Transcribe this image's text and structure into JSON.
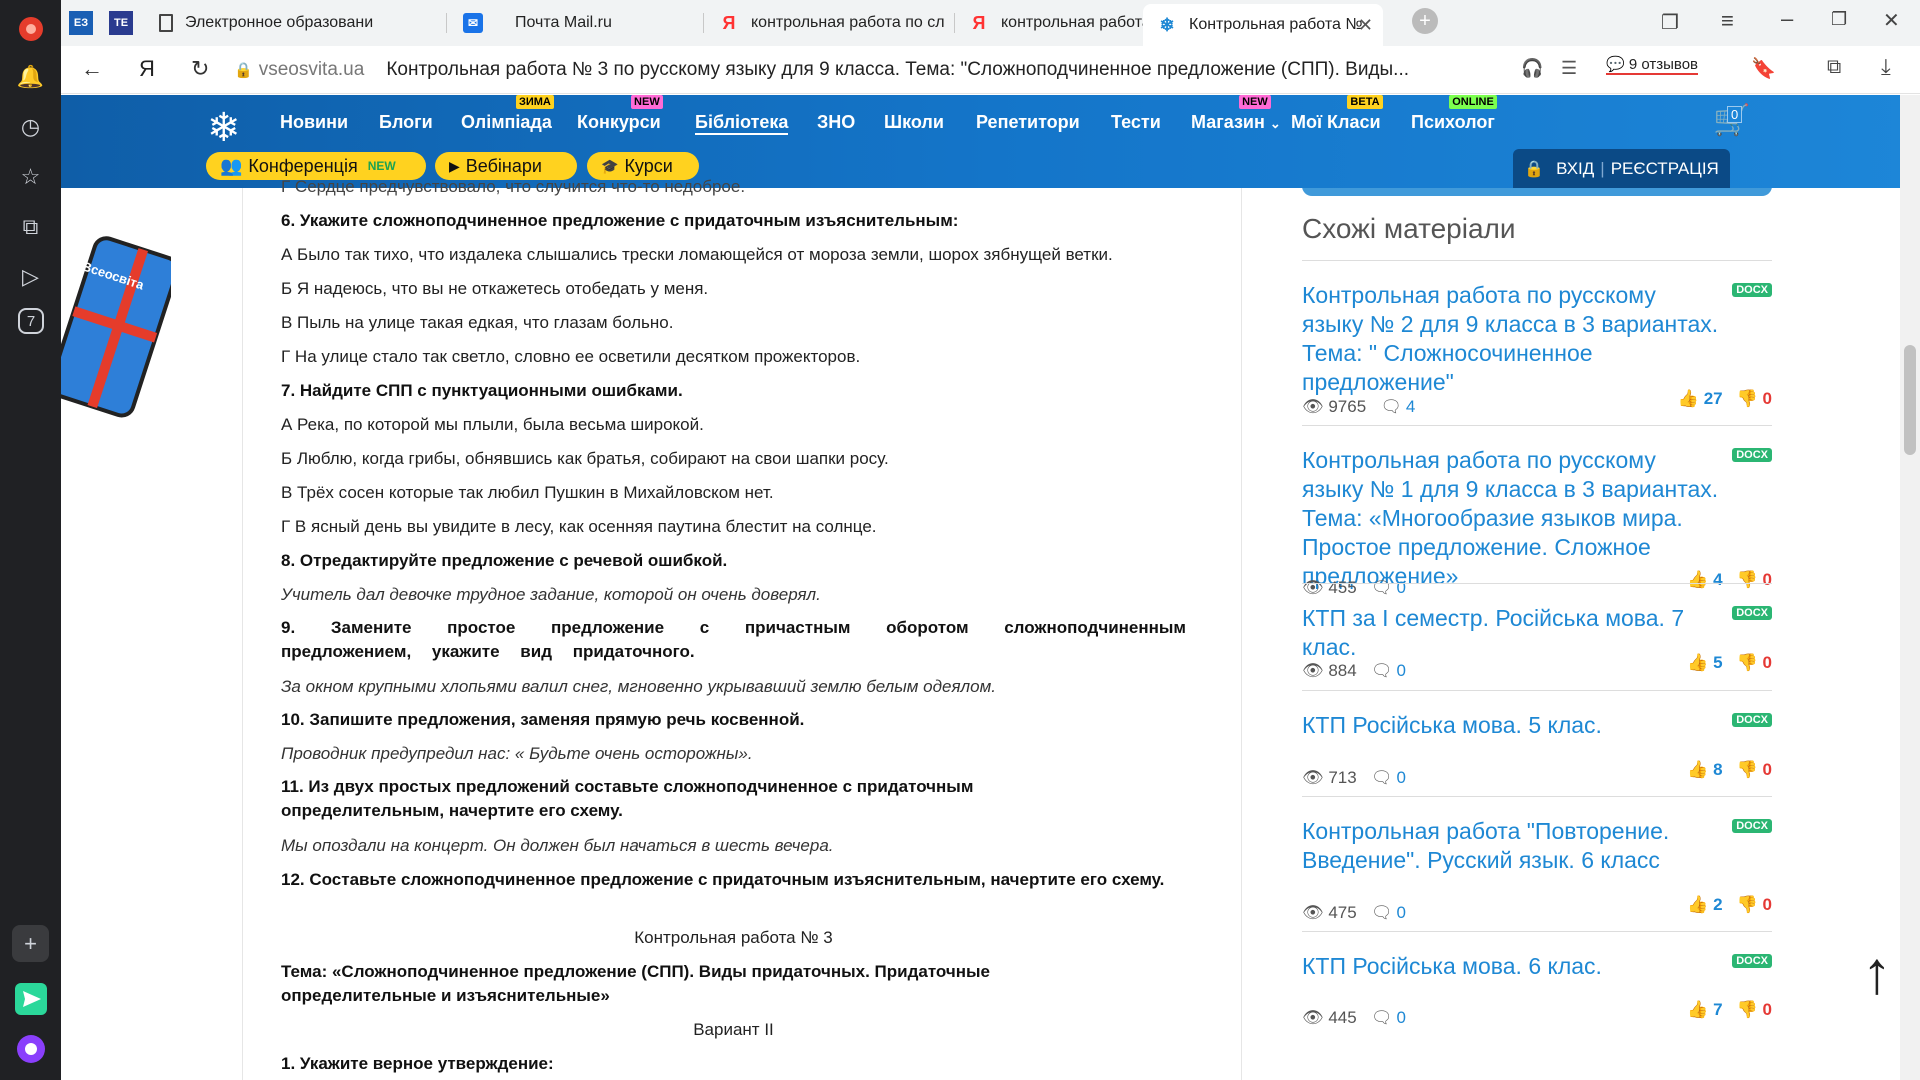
{
  "browser": {
    "tabs": [
      {
        "label": "Электронное образовани",
        "icon": "page-icon"
      },
      {
        "label": "Почта Mail.ru",
        "icon": "mail-icon"
      },
      {
        "label": "контрольная работа по сл",
        "icon": "yandex-icon"
      },
      {
        "label": "контрольная работа по сл",
        "icon": "yandex-icon"
      },
      {
        "label": "Контрольная работа №",
        "icon": "snowflake-icon"
      }
    ],
    "address": {
      "domain": "vseosvita.ua",
      "title": "Контрольная работа № 3 по русскому языку для 9 класса. Тема: \"Сложноподчиненное предложение (СПП). Виды...",
      "reviews": "9 отзывов"
    },
    "side_badge": "7"
  },
  "header": {
    "nav": [
      {
        "label": "Новини",
        "badge": ""
      },
      {
        "label": "Блоги",
        "badge": ""
      },
      {
        "label": "Олімпіада",
        "badge": "ЗИМА"
      },
      {
        "label": "Конкурси",
        "badge": "NEW"
      },
      {
        "label": "Бібліотека",
        "badge": ""
      },
      {
        "label": "ЗНО",
        "badge": ""
      },
      {
        "label": "Школи",
        "badge": ""
      },
      {
        "label": "Репетитори",
        "badge": ""
      },
      {
        "label": "Тести",
        "badge": ""
      },
      {
        "label": "Магазин",
        "badge": "NEW"
      },
      {
        "label": "Мої Класи",
        "badge": "BETA"
      },
      {
        "label": "Психолог",
        "badge": "ONLINE"
      }
    ],
    "pills": {
      "conference": "Конференція",
      "conference_new": "NEW",
      "webinars": "Вебінари",
      "courses": "Курси"
    },
    "login": "ВХІД",
    "register": "РЕЄСТРАЦІЯ",
    "cart_count": "0",
    "badge_colors": {
      "ЗИМА": "#ffd21f",
      "NEW": "#ff6bd6",
      "BETA": "#ffd21f",
      "ONLINE": "#7cff4f"
    }
  },
  "content": {
    "cut_line": "Г Сердце предчувствовало, что случится что-то недоброе.",
    "q6": "6. Укажите сложноподчиненное предложение с придаточным изъяснительным:",
    "q6a": "А Было так тихо, что издалека слышались трески ломающейся от мороза земли, шорох зябнущей ветки.",
    "q6b": "Б Я надеюсь, что вы не откажетесь отобедать у меня.",
    "q6c": "В Пыль на улице такая едкая, что глазам больно.",
    "q6d": "Г На улице стало так светло, словно ее осветили десятком прожекторов.",
    "q7": "7. Найдите СПП с пунктуационными ошибками.",
    "q7a": "А Река, по которой мы плыли, была весьма широкой.",
    "q7b": "Б Люблю, когда грибы, обнявшись как братья, собирают на свои шапки росу.",
    "q7c": "В Трёх сосен которые так любил Пушкин в Михайловском нет.",
    "q7d": "Г В ясный день вы увидите в лесу, как осенняя паутина блестит на солнце.",
    "q8": "8. Отредактируйте предложение с речевой ошибкой.",
    "q8t": "Учитель дал девочке трудное задание, которой он очень доверял.",
    "q9": "9. Замените простое предложение с причастным оборотом сложноподчиненным предложением, укажите вид придаточного.",
    "q9t": "За окном крупными хлопьями валил снег, мгновенно укрывавший землю белым одеялом.",
    "q10": "10. Запишите предложения, заменяя прямую речь косвенной.",
    "q10t": "Проводник предупредил нас: « Будьте очень осторожны».",
    "q11": "11. Из двух простых предложений составьте сложноподчиненное с придаточным определительным, начертите его схему.",
    "q11t": "Мы опоздали на концерт. Он должен был начаться в шесть вечера.",
    "q12": "12. Составьте сложноподчиненное предложение с придаточным изъяснительным, начертите его схему.",
    "work_title": "Контрольная работа № 3",
    "topic": "Тема: «Сложноподчиненное предложение (СПП). Виды придаточных. Придаточные определительные и изъяснительные»",
    "variant": "Вариант II",
    "v2q1": "1. Укажите верное утверждение:"
  },
  "sidebar": {
    "title": "Схожі матеріали",
    "items": [
      {
        "title": "Контрольная работа по русскому языку № 2 для 9 класса в 3 вариантах. Тема: \" Сложносочиненное предложение\"",
        "type": "DOCX",
        "views": "9765",
        "comments": "4",
        "likes": "27",
        "dislikes": "0"
      },
      {
        "title": "Контрольная работа по русскому языку № 1 для 9 класса в 3 вариантах. Тема: «Многообразие языков мира. Простое предложение. Сложное предложение»",
        "type": "DOCX",
        "views": "455",
        "comments": "0",
        "likes": "4",
        "dislikes": "0"
      },
      {
        "title": "КТП за І семестр. Російська мова. 7 клас.",
        "type": "DOCX",
        "views": "884",
        "comments": "0",
        "likes": "5",
        "dislikes": "0"
      },
      {
        "title": "КТП Російська мова. 5 клас.",
        "type": "DOCX",
        "views": "713",
        "comments": "0",
        "likes": "8",
        "dislikes": "0"
      },
      {
        "title": "Контрольная работа \"Повторение. Введение\". Русский язык. 6 класс",
        "type": "DOCX",
        "views": "475",
        "comments": "0",
        "likes": "2",
        "dislikes": "0"
      },
      {
        "title": "КТП Російська мова. 6 клас.",
        "type": "DOCX",
        "views": "445",
        "comments": "0",
        "likes": "7",
        "dislikes": "0"
      }
    ]
  },
  "promo": {
    "label": "Всеосвіта"
  }
}
